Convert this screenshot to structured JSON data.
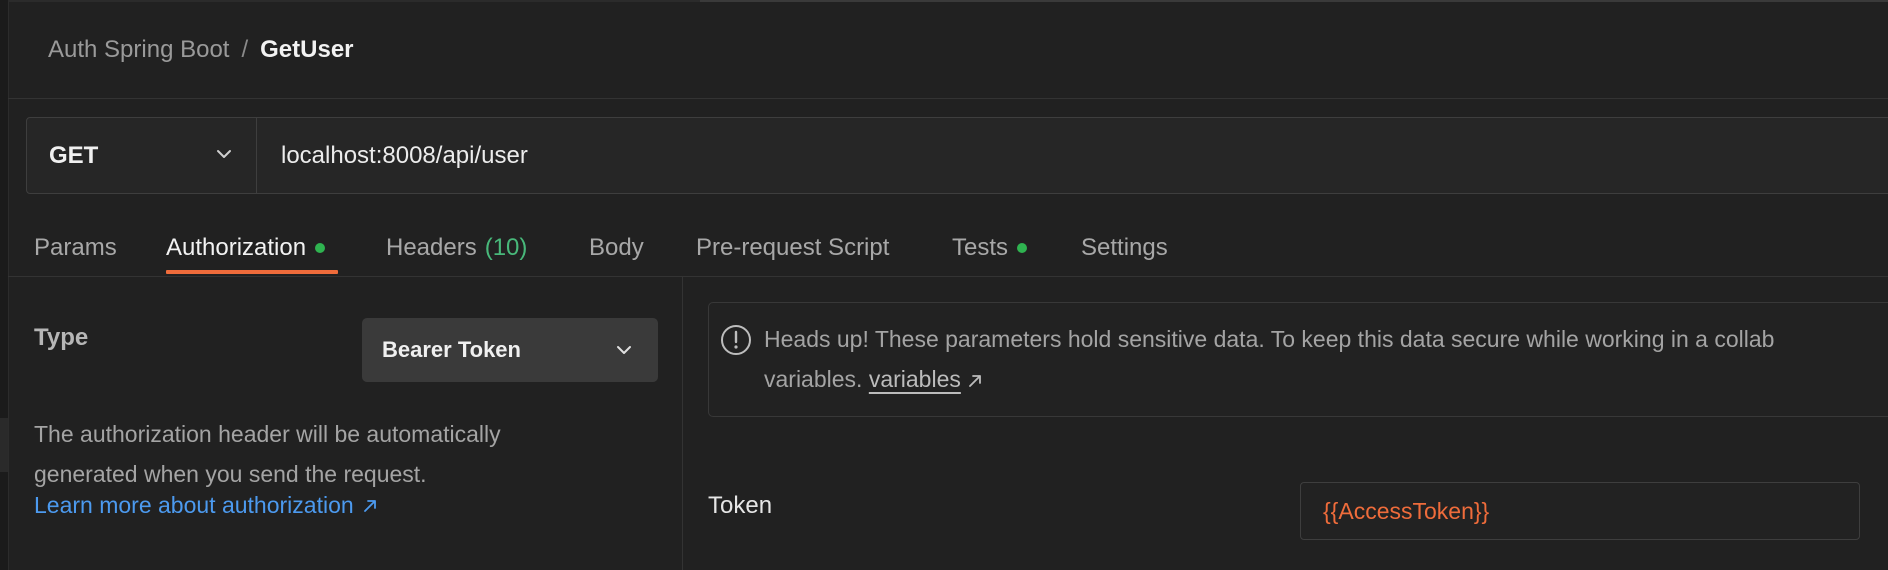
{
  "breadcrumb": {
    "parent": "Auth Spring Boot",
    "separator": "/",
    "current": "GetUser"
  },
  "request": {
    "method": "GET",
    "url": "localhost:8008/api/user"
  },
  "tabs": {
    "params": "Params",
    "authorization": "Authorization",
    "headers": "Headers",
    "headers_count": "(10)",
    "body": "Body",
    "prerequest": "Pre-request Script",
    "tests": "Tests",
    "settings": "Settings",
    "active": "authorization"
  },
  "auth": {
    "type_label": "Type",
    "type_value": "Bearer Token",
    "description_line1": "The authorization header will be automatically",
    "description_line2": "generated when you send the request.",
    "learn_more": "Learn more about authorization"
  },
  "notice": {
    "line1": "Heads up! These parameters hold sensitive data. To keep this data secure while working in a collab",
    "line2_prefix": "variables.",
    "link": "variables"
  },
  "token": {
    "label": "Token",
    "value": "{{AccessToken}}"
  },
  "colors": {
    "accent": "#ef6c3b",
    "status_dot": "#2fb350",
    "link": "#4c9aef",
    "count": "#48b87a",
    "background": "#212121"
  },
  "icons": {
    "method_dropdown": "chevron-down-icon",
    "type_dropdown": "chevron-down-icon",
    "notice": "alert-circle-icon",
    "external_link": "arrow-up-right-icon"
  }
}
